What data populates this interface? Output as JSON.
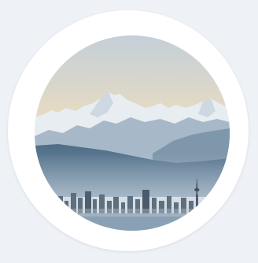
{
  "image": {
    "subject": "mountain-city-skyline",
    "colors": {
      "page_background": "#eef1f6",
      "frame": "#ffffff",
      "sky_top": "#c9d3dc",
      "sky_glow": "#f1d7a8",
      "snow_peaks": "#e7ecf1",
      "mid_mountains": "#9fb1c3",
      "foothills": "#5f7890",
      "city_haze": "#8ea2b5"
    }
  }
}
